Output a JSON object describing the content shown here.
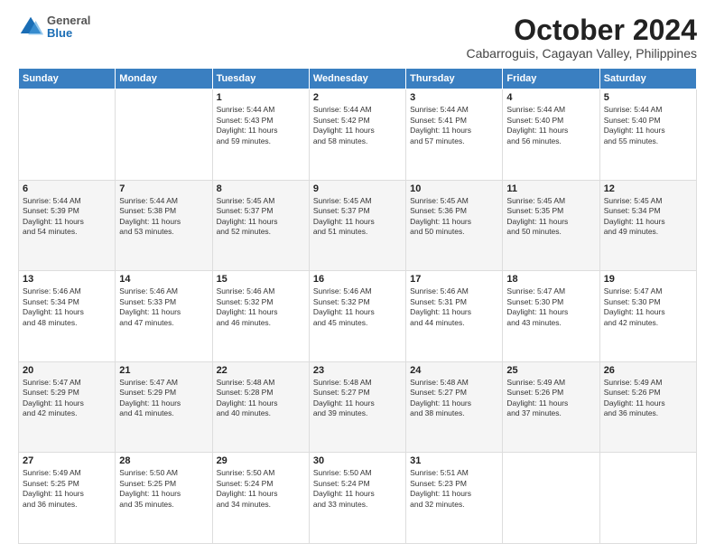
{
  "logo": {
    "general": "General",
    "blue": "Blue"
  },
  "title": "October 2024",
  "subtitle": "Cabarroguis, Cagayan Valley, Philippines",
  "headers": [
    "Sunday",
    "Monday",
    "Tuesday",
    "Wednesday",
    "Thursday",
    "Friday",
    "Saturday"
  ],
  "weeks": [
    [
      {
        "day": "",
        "info": ""
      },
      {
        "day": "",
        "info": ""
      },
      {
        "day": "1",
        "info": "Sunrise: 5:44 AM\nSunset: 5:43 PM\nDaylight: 11 hours\nand 59 minutes."
      },
      {
        "day": "2",
        "info": "Sunrise: 5:44 AM\nSunset: 5:42 PM\nDaylight: 11 hours\nand 58 minutes."
      },
      {
        "day": "3",
        "info": "Sunrise: 5:44 AM\nSunset: 5:41 PM\nDaylight: 11 hours\nand 57 minutes."
      },
      {
        "day": "4",
        "info": "Sunrise: 5:44 AM\nSunset: 5:40 PM\nDaylight: 11 hours\nand 56 minutes."
      },
      {
        "day": "5",
        "info": "Sunrise: 5:44 AM\nSunset: 5:40 PM\nDaylight: 11 hours\nand 55 minutes."
      }
    ],
    [
      {
        "day": "6",
        "info": "Sunrise: 5:44 AM\nSunset: 5:39 PM\nDaylight: 11 hours\nand 54 minutes."
      },
      {
        "day": "7",
        "info": "Sunrise: 5:44 AM\nSunset: 5:38 PM\nDaylight: 11 hours\nand 53 minutes."
      },
      {
        "day": "8",
        "info": "Sunrise: 5:45 AM\nSunset: 5:37 PM\nDaylight: 11 hours\nand 52 minutes."
      },
      {
        "day": "9",
        "info": "Sunrise: 5:45 AM\nSunset: 5:37 PM\nDaylight: 11 hours\nand 51 minutes."
      },
      {
        "day": "10",
        "info": "Sunrise: 5:45 AM\nSunset: 5:36 PM\nDaylight: 11 hours\nand 50 minutes."
      },
      {
        "day": "11",
        "info": "Sunrise: 5:45 AM\nSunset: 5:35 PM\nDaylight: 11 hours\nand 50 minutes."
      },
      {
        "day": "12",
        "info": "Sunrise: 5:45 AM\nSunset: 5:34 PM\nDaylight: 11 hours\nand 49 minutes."
      }
    ],
    [
      {
        "day": "13",
        "info": "Sunrise: 5:46 AM\nSunset: 5:34 PM\nDaylight: 11 hours\nand 48 minutes."
      },
      {
        "day": "14",
        "info": "Sunrise: 5:46 AM\nSunset: 5:33 PM\nDaylight: 11 hours\nand 47 minutes."
      },
      {
        "day": "15",
        "info": "Sunrise: 5:46 AM\nSunset: 5:32 PM\nDaylight: 11 hours\nand 46 minutes."
      },
      {
        "day": "16",
        "info": "Sunrise: 5:46 AM\nSunset: 5:32 PM\nDaylight: 11 hours\nand 45 minutes."
      },
      {
        "day": "17",
        "info": "Sunrise: 5:46 AM\nSunset: 5:31 PM\nDaylight: 11 hours\nand 44 minutes."
      },
      {
        "day": "18",
        "info": "Sunrise: 5:47 AM\nSunset: 5:30 PM\nDaylight: 11 hours\nand 43 minutes."
      },
      {
        "day": "19",
        "info": "Sunrise: 5:47 AM\nSunset: 5:30 PM\nDaylight: 11 hours\nand 42 minutes."
      }
    ],
    [
      {
        "day": "20",
        "info": "Sunrise: 5:47 AM\nSunset: 5:29 PM\nDaylight: 11 hours\nand 42 minutes."
      },
      {
        "day": "21",
        "info": "Sunrise: 5:47 AM\nSunset: 5:29 PM\nDaylight: 11 hours\nand 41 minutes."
      },
      {
        "day": "22",
        "info": "Sunrise: 5:48 AM\nSunset: 5:28 PM\nDaylight: 11 hours\nand 40 minutes."
      },
      {
        "day": "23",
        "info": "Sunrise: 5:48 AM\nSunset: 5:27 PM\nDaylight: 11 hours\nand 39 minutes."
      },
      {
        "day": "24",
        "info": "Sunrise: 5:48 AM\nSunset: 5:27 PM\nDaylight: 11 hours\nand 38 minutes."
      },
      {
        "day": "25",
        "info": "Sunrise: 5:49 AM\nSunset: 5:26 PM\nDaylight: 11 hours\nand 37 minutes."
      },
      {
        "day": "26",
        "info": "Sunrise: 5:49 AM\nSunset: 5:26 PM\nDaylight: 11 hours\nand 36 minutes."
      }
    ],
    [
      {
        "day": "27",
        "info": "Sunrise: 5:49 AM\nSunset: 5:25 PM\nDaylight: 11 hours\nand 36 minutes."
      },
      {
        "day": "28",
        "info": "Sunrise: 5:50 AM\nSunset: 5:25 PM\nDaylight: 11 hours\nand 35 minutes."
      },
      {
        "day": "29",
        "info": "Sunrise: 5:50 AM\nSunset: 5:24 PM\nDaylight: 11 hours\nand 34 minutes."
      },
      {
        "day": "30",
        "info": "Sunrise: 5:50 AM\nSunset: 5:24 PM\nDaylight: 11 hours\nand 33 minutes."
      },
      {
        "day": "31",
        "info": "Sunrise: 5:51 AM\nSunset: 5:23 PM\nDaylight: 11 hours\nand 32 minutes."
      },
      {
        "day": "",
        "info": ""
      },
      {
        "day": "",
        "info": ""
      }
    ]
  ]
}
